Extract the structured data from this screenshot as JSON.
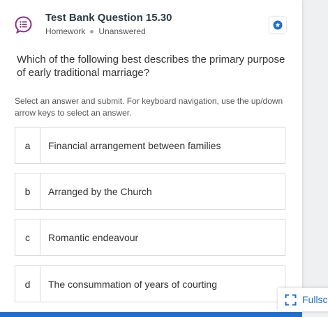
{
  "header": {
    "title": "Test Bank Question 15.30",
    "type": "Homework",
    "status": "Unanswered",
    "icon": "question-list-icon",
    "bookmark_icon": "star-icon"
  },
  "question": {
    "text": "Which of the following best describes the primary purpose of early traditional marriage?"
  },
  "instructions": "Select an answer and submit. For keyboard navigation, use the up/down arrow keys to select an answer.",
  "options": [
    {
      "letter": "a",
      "text": "Financial arrangement between families"
    },
    {
      "letter": "b",
      "text": "Arranged by the Church"
    },
    {
      "letter": "c",
      "text": "Romantic endeavour"
    },
    {
      "letter": "d",
      "text": "The consummation of years of courting"
    }
  ],
  "fullscreen": {
    "label": "Fullsc",
    "icon": "fullscreen-icon"
  },
  "colors": {
    "accent": "#1f6fd1",
    "icon_purple": "#8a2e8c"
  }
}
